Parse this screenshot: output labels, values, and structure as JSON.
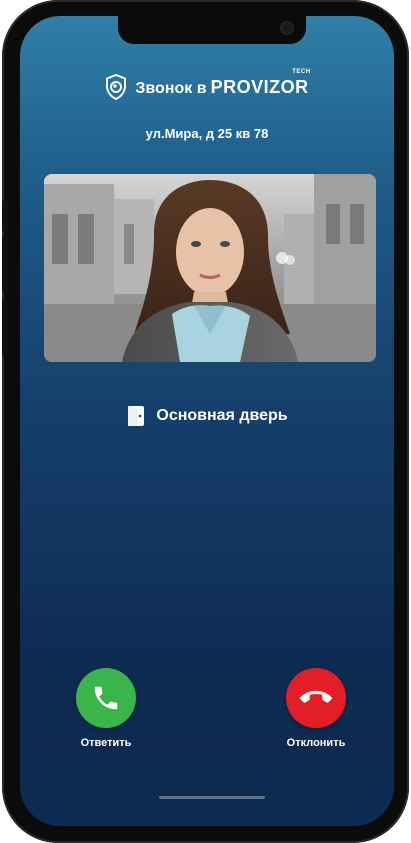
{
  "brand": {
    "prefix": "Звонок в",
    "name": "PROVIZOR",
    "tag": "TECH"
  },
  "call": {
    "address": "ул.Мира, д 25 кв 78",
    "door_label": "Основная дверь"
  },
  "actions": {
    "answer_label": "Ответить",
    "decline_label": "Отклонить"
  },
  "colors": {
    "answer": "#39b54a",
    "decline": "#e41e26",
    "background_top": "#2f7fa7",
    "background_bottom": "#0d2a50"
  },
  "icons": {
    "brand": "shield-eye-icon",
    "door": "door-icon",
    "answer": "phone-icon",
    "decline": "phone-hangup-icon"
  }
}
